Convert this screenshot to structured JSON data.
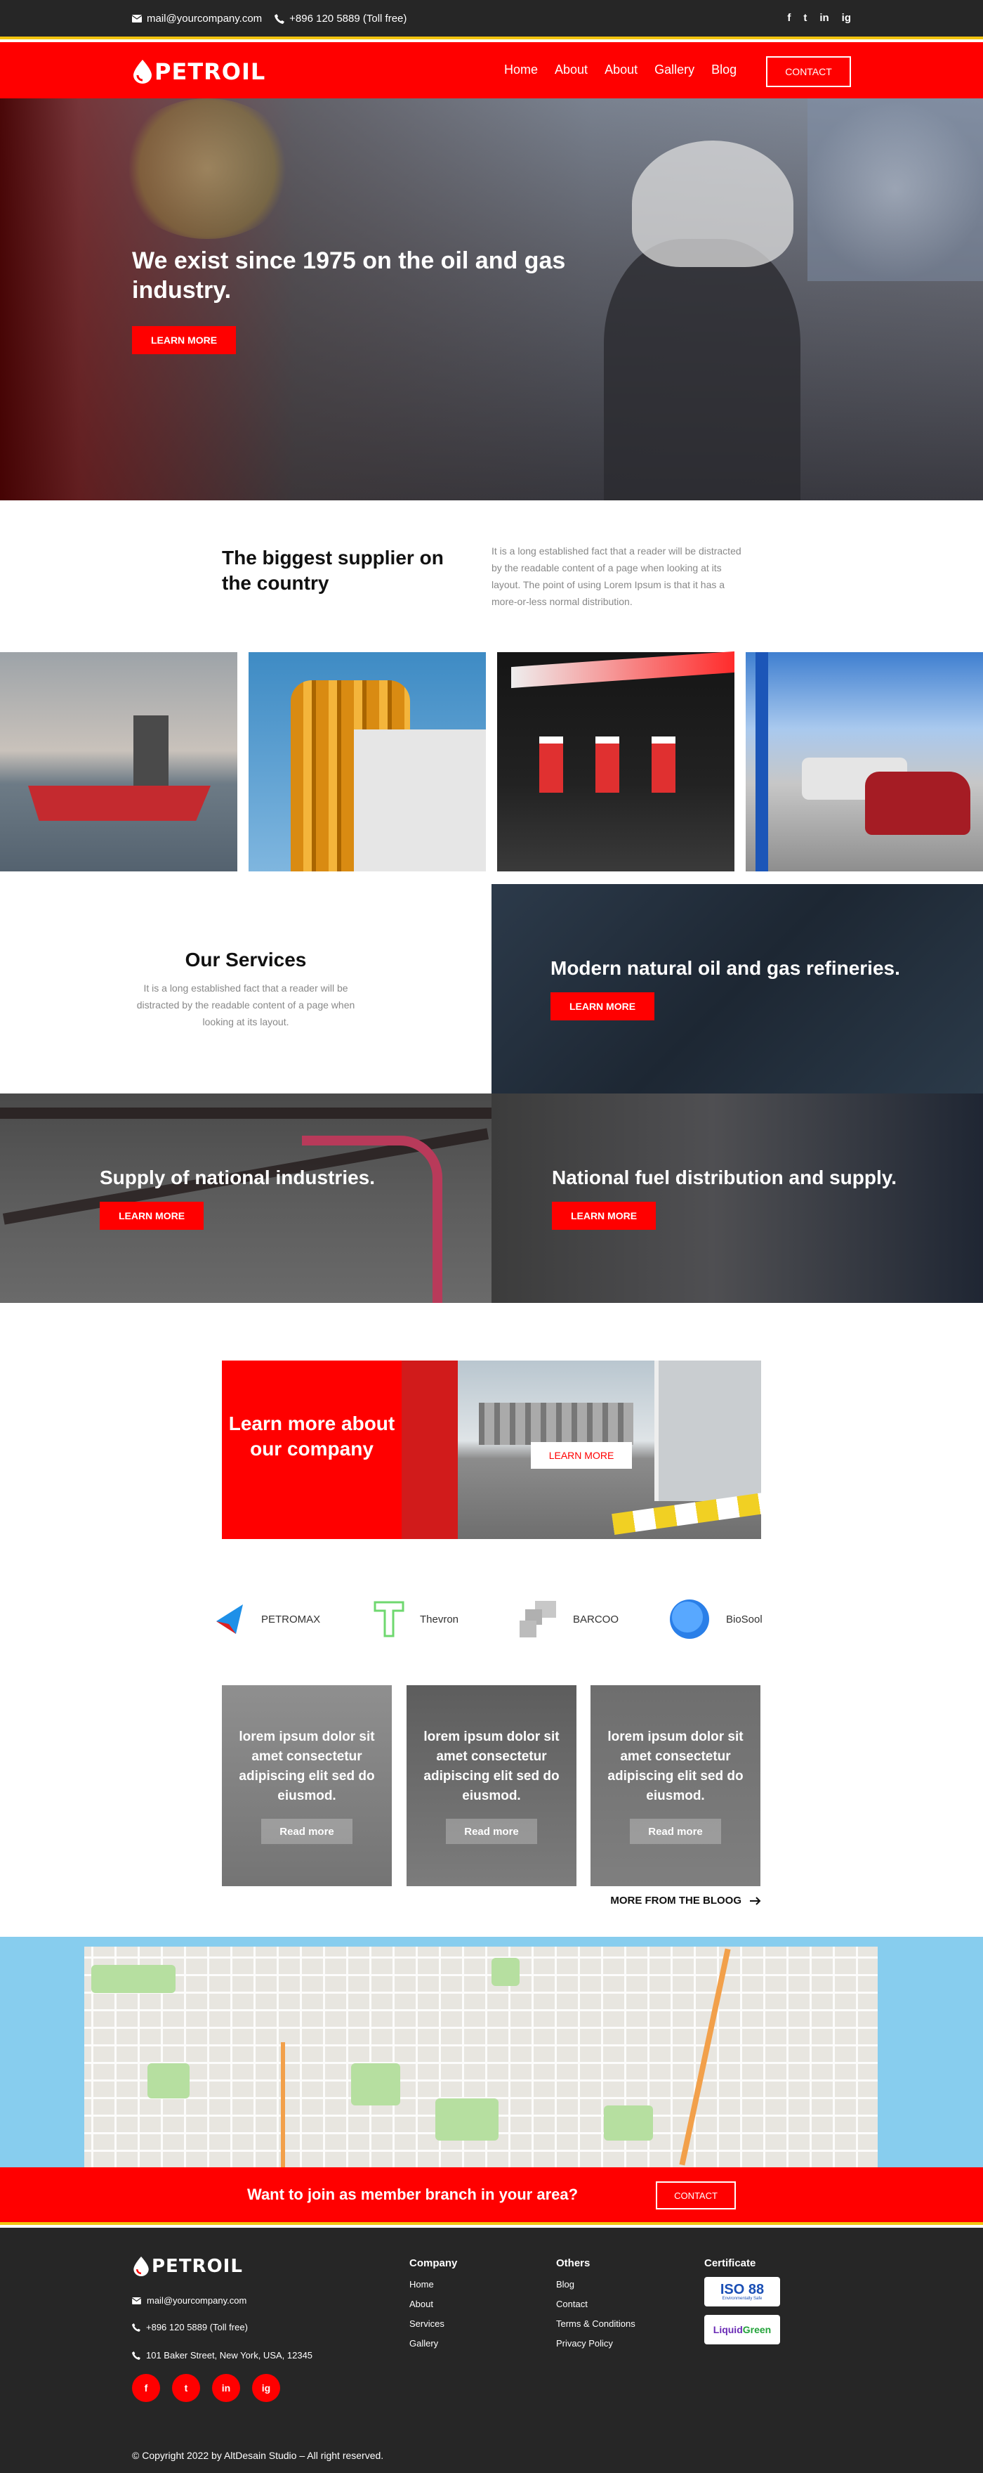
{
  "topbar": {
    "email": "mail@yourcompany.com",
    "phone": "+896 120 5889 (Toll free)",
    "social": [
      "f",
      "t",
      "in",
      "ig"
    ]
  },
  "brand": {
    "name": "PETROIL"
  },
  "nav": {
    "items": [
      "Home",
      "About",
      "About",
      "Gallery",
      "Blog"
    ],
    "contact": "CONTACT"
  },
  "hero": {
    "title": "We exist since 1975 on the oil and gas industry.",
    "button": "LEARN MORE"
  },
  "intro": {
    "title": "The biggest supplier on the country",
    "text": "It is a long established fact that a reader will be distracted by the readable content of a page when looking at its layout. The point of using Lorem Ipsum is that it has a more-or-less normal distribution."
  },
  "services": {
    "title": "Our Services",
    "text": "It is a long established fact that a reader will be distracted by the readable content of a page when looking at its layout.",
    "panels": [
      {
        "title": "Modern natural oil and gas refineries.",
        "button": "LEARN MORE"
      },
      {
        "title": "Supply of national industries.",
        "button": "LEARN MORE"
      },
      {
        "title": "National fuel distribution and supply.",
        "button": "LEARN MORE"
      }
    ]
  },
  "about_cta": {
    "title": "Learn more about our company",
    "button": "LEARN MORE"
  },
  "partners": [
    "PETROMAX",
    "Thevron",
    "BARCOO",
    "BioSool"
  ],
  "blog": {
    "cards": [
      {
        "title": "lorem ipsum dolor sit amet consectetur adipiscing elit sed do eiusmod.",
        "button": "Read more"
      },
      {
        "title": "lorem ipsum dolor sit amet consectetur adipiscing elit sed do eiusmod.",
        "button": "Read more"
      },
      {
        "title": "lorem ipsum dolor sit amet consectetur adipiscing elit sed do eiusmod.",
        "button": "Read more"
      }
    ],
    "more": "MORE FROM THE BLOOG"
  },
  "join": {
    "title": "Want to join as member branch in your area?",
    "button": "CONTACT"
  },
  "footer": {
    "email": "mail@yourcompany.com",
    "phone": "+896 120 5889 (Toll free)",
    "address": "101 Baker Street, New York, USA, 12345",
    "company": {
      "title": "Company",
      "items": [
        "Home",
        "About",
        "Services",
        "Gallery"
      ]
    },
    "others": {
      "title": "Others",
      "items": [
        "Blog",
        "Contact",
        "Terms & Conditions",
        "Privacy Policy"
      ]
    },
    "certificate": {
      "title": "Certificate",
      "iso": "ISO 88",
      "iso_sub": "Environmentally Safe",
      "liquid": "Liquid",
      "green": "Green"
    },
    "social": [
      "f",
      "t",
      "in",
      "ig"
    ],
    "copyright": "© Copyright 2022 by AltDesain Studio – All right reserved."
  },
  "colors": {
    "accent": "#ff0000",
    "dark": "#262626",
    "stripe": "#f2c40f"
  }
}
